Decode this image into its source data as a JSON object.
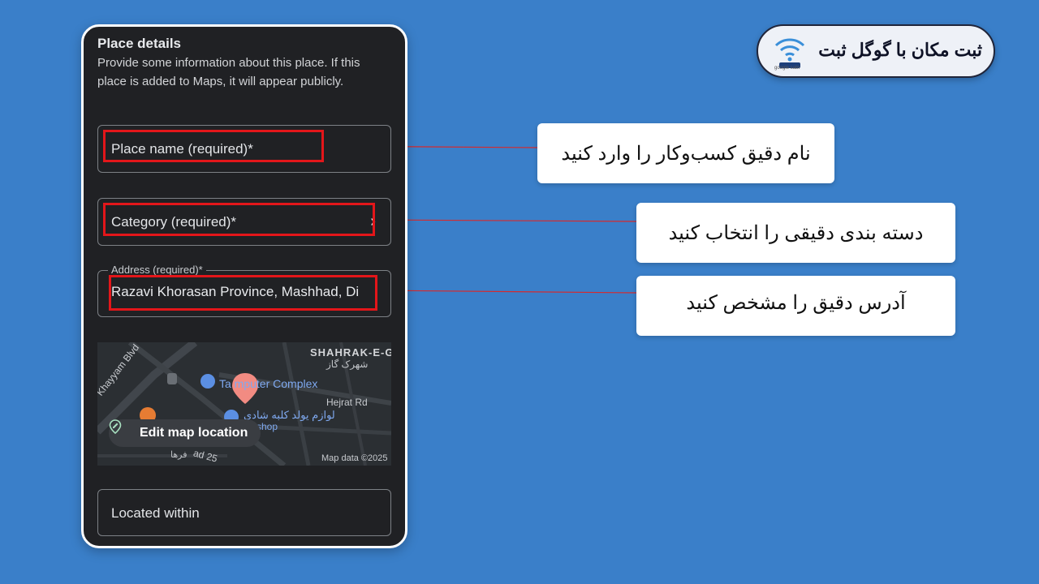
{
  "panel": {
    "title": "Place details",
    "description": "Provide some information about this place. If this place is added to Maps, it will appear publicly.",
    "fields": {
      "place_name": "Place name (required)*",
      "category": "Category (required)*",
      "address_label": "Address (required)*",
      "address_value": "Razavi Khorasan Province, Mashhad, Di",
      "located_within": "Located within"
    },
    "map": {
      "edit_button": "Edit map location",
      "attribution": "Map data ©2025",
      "labels": {
        "district": "SHAHRAK-E-G",
        "district_fa": "شهرک گاز",
        "complex": "Ta   mputer Complex",
        "street1": "Hejrat Rd",
        "blvd": "Khayyam Blvd",
        "shop_fa": "لوازم یولد کلبه شادی",
        "shop": "l shop",
        "street2": "ad 25",
        "street3": "فرها"
      }
    }
  },
  "badge": {
    "title": "ثبت مکان با گوگل ثبت",
    "logo_sub": "google sabt"
  },
  "callouts": [
    "نام دقیق کسب‌وکار را وارد کنید",
    "دسته بندی دقیقی را انتخاب کنید",
    "آدرس دقیق را مشخص کنید"
  ],
  "colors": {
    "background": "#3a7fc9",
    "highlight": "#e3161a",
    "panel": "#202124",
    "pin": "#f28b82"
  },
  "icons": [
    "chevron-right-icon",
    "edit-location-icon",
    "map-pin-icon",
    "wifi-logo-icon"
  ]
}
